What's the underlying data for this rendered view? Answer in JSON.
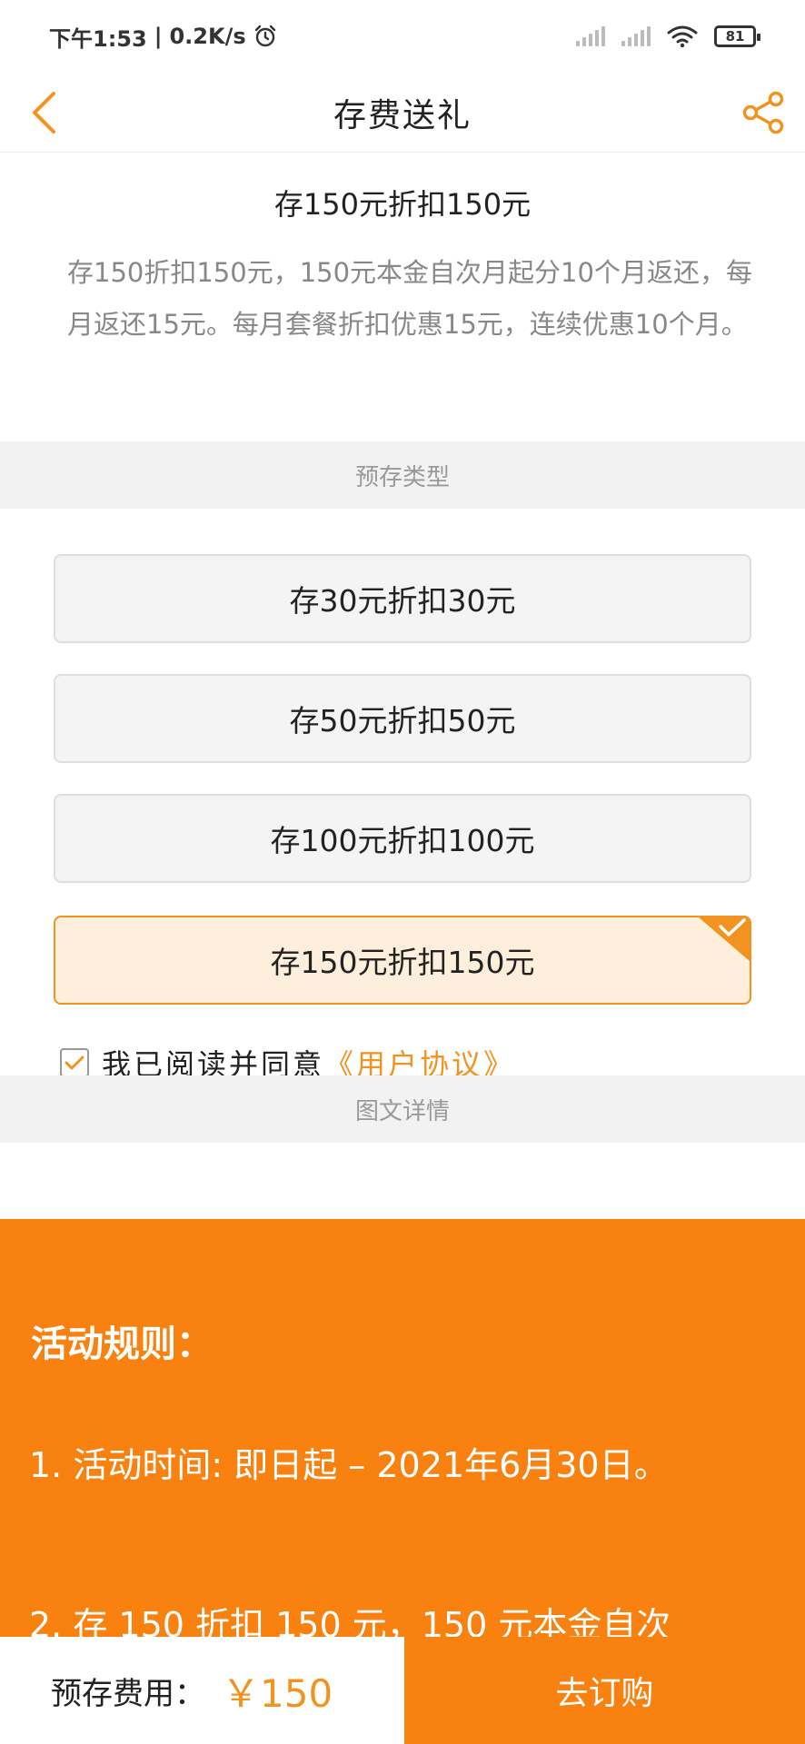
{
  "status_bar": {
    "time": "下午1:53",
    "speed": "0.2K/s",
    "battery": "81"
  },
  "header": {
    "title": "存费送礼"
  },
  "intro": {
    "title": "存150元折扣150元",
    "description": "存150折扣150元，150元本金自次月起分10个月返还，每月返还15元。每月套餐折扣优惠15元，连续优惠10个月。"
  },
  "section_type": "预存类型",
  "options": [
    {
      "label": "存30元折扣30元"
    },
    {
      "label": "存50元折扣50元"
    },
    {
      "label": "存100元折扣100元"
    },
    {
      "label": "存150元折扣150元",
      "selected": true
    }
  ],
  "agreement": {
    "text": "我已阅读并同意",
    "link": "《用户协议》",
    "checked": true
  },
  "section_details": "图文详情",
  "details": {
    "rules_title": "活动规则：",
    "rule_1": "1. 活动时间: 即日起 – 2021年6月30日。",
    "rule_2": "2. 存 150 折扣 150 元，150 元本金自次"
  },
  "bottom": {
    "price_label": "预存费用：",
    "price_value": "￥150",
    "order_label": "去订购"
  },
  "colors": {
    "accent": "#f2931f",
    "orange_bg": "#f8810f",
    "selected_bg": "#fdefdb"
  }
}
